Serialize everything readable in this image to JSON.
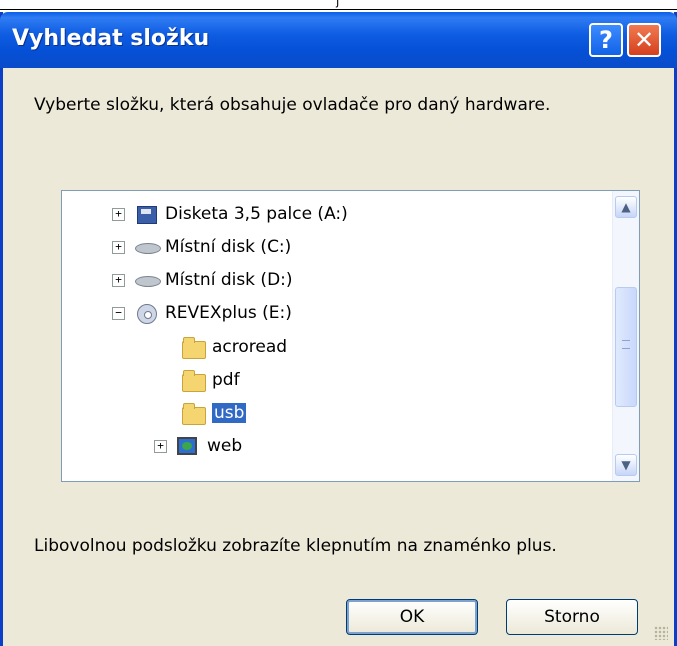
{
  "top_strip": {
    "glyph": "j"
  },
  "dialog": {
    "title": "Vyhledat složku",
    "help_label": "?",
    "close_label": "✕",
    "instruction": "Vyberte složku, která obsahuje ovladače pro daný hardware.",
    "tree": [
      {
        "label": "Disketa 3,5 palce (A:)",
        "expander": "+",
        "icon": "floppy-icon"
      },
      {
        "label": "Místní disk (C:)",
        "expander": "+",
        "icon": "hard-disk-icon"
      },
      {
        "label": "Místní disk (D:)",
        "expander": "+",
        "icon": "hard-disk-icon"
      },
      {
        "label": "REVEXplus (E:)",
        "expander": "−",
        "icon": "cd-drive-icon"
      },
      {
        "label": "acroread",
        "icon": "folder-icon"
      },
      {
        "label": "pdf",
        "icon": "folder-icon"
      },
      {
        "label": "usb",
        "icon": "folder-open-icon",
        "selected": true
      },
      {
        "label": "web",
        "expander": "+",
        "icon": "web-folder-icon"
      }
    ],
    "hint": "Libovolnou podsložku zobrazíte klepnutím na znaménko plus.",
    "ok_label": "OK",
    "cancel_label": "Storno"
  }
}
